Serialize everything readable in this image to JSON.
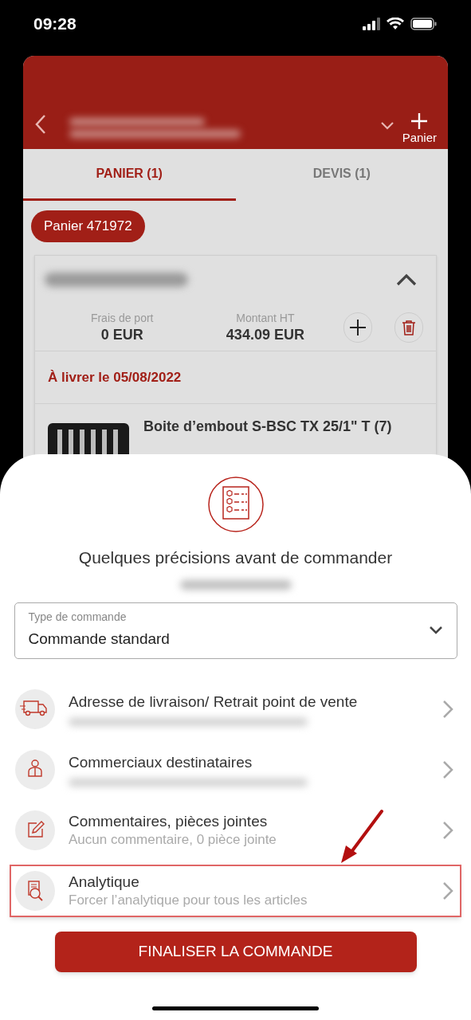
{
  "status_bar": {
    "time": "09:28"
  },
  "header": {
    "add_label": "Panier",
    "title_redacted": true
  },
  "tabs": [
    {
      "label": "PANIER (1)",
      "selected": true
    },
    {
      "label": "DEVIS (1)",
      "selected": false
    }
  ],
  "cart_chip": "Panier 471972",
  "order": {
    "expanded": true,
    "totals": [
      {
        "label": "Frais de port",
        "value": "0 EUR"
      },
      {
        "label": "Montant HT",
        "value": "434.09 EUR"
      }
    ],
    "delivery": "À livrer le 05/08/2022",
    "products": [
      {
        "name": "Boite d’embout S-BSC TX 25/1\" T (7)"
      }
    ]
  },
  "sheet": {
    "title": "Quelques précisions avant de commander",
    "order_type": {
      "label": "Type de commande",
      "value": "Commande standard"
    },
    "rows": [
      {
        "kind": "truck",
        "title": "Adresse de livraison/ Retrait point de vente",
        "subtitle_redacted": true,
        "highlighted": false
      },
      {
        "kind": "person",
        "title": "Commerciaux destinataires",
        "subtitle_redacted": true,
        "highlighted": false
      },
      {
        "kind": "pencil",
        "title": "Commentaires, pièces jointes",
        "subtitle": "Aucun commentaire, 0 pièce jointe",
        "highlighted": false
      },
      {
        "kind": "analytics",
        "title": "Analytique",
        "subtitle": "Forcer l’analytique pour tous les articles",
        "highlighted": true
      }
    ],
    "button": "FINALISER LA COMMANDE"
  }
}
